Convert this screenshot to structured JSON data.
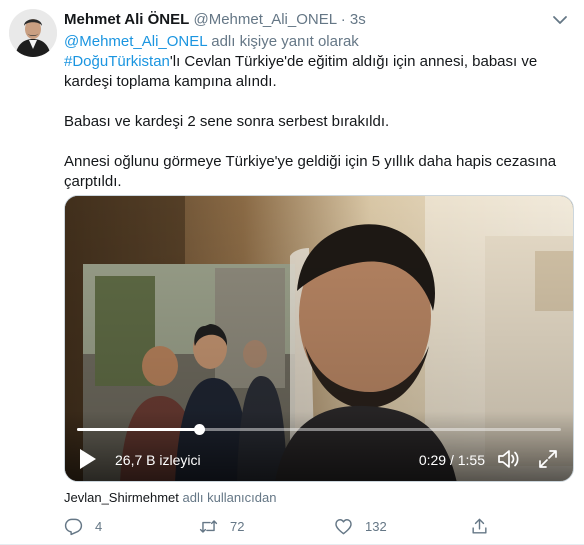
{
  "tweet": {
    "author_name": "Mehmet Ali ÖNEL",
    "author_handle": "@Mehmet_Ali_ONEL",
    "separator": "·",
    "timestamp": "3s",
    "reply_to_handle": "@Mehmet_Ali_ONEL",
    "reply_to_suffix": "adlı kişiye yanıt olarak",
    "hashtag": "#DoğuTürkistan",
    "paragraph1_rest": "'lı Cevlan Türkiye'de eğitim aldığı için annesi, babası ve kardeşi toplama kampına alındı.",
    "paragraph2": "Babası ve kardeşi 2 sene sonra serbest bırakıldı.",
    "paragraph3": "Annesi oğlunu görmeye Türkiye'ye geldiği için 5 yıllık daha hapis cezasına çarptıldı."
  },
  "video": {
    "views": "26,7 B izleyici",
    "time": "0:29 / 1:55",
    "progress": 0.252
  },
  "attribution": {
    "user": "Jevlan_Shirmehmet",
    "suffix": "adlı kullanıcıdan"
  },
  "actions": {
    "reply_count": "4",
    "retweet_count": "72",
    "like_count": "132"
  },
  "icons": {
    "reply": "reply-icon",
    "retweet": "retweet-icon",
    "like": "heart-icon",
    "share": "share-icon",
    "play": "play-icon",
    "volume": "volume-icon",
    "fullscreen": "fullscreen-icon",
    "more": "chevron-down-icon"
  },
  "colors": {
    "link": "#1b95e0",
    "secondary_text": "#657786",
    "primary_text": "#14171a"
  }
}
